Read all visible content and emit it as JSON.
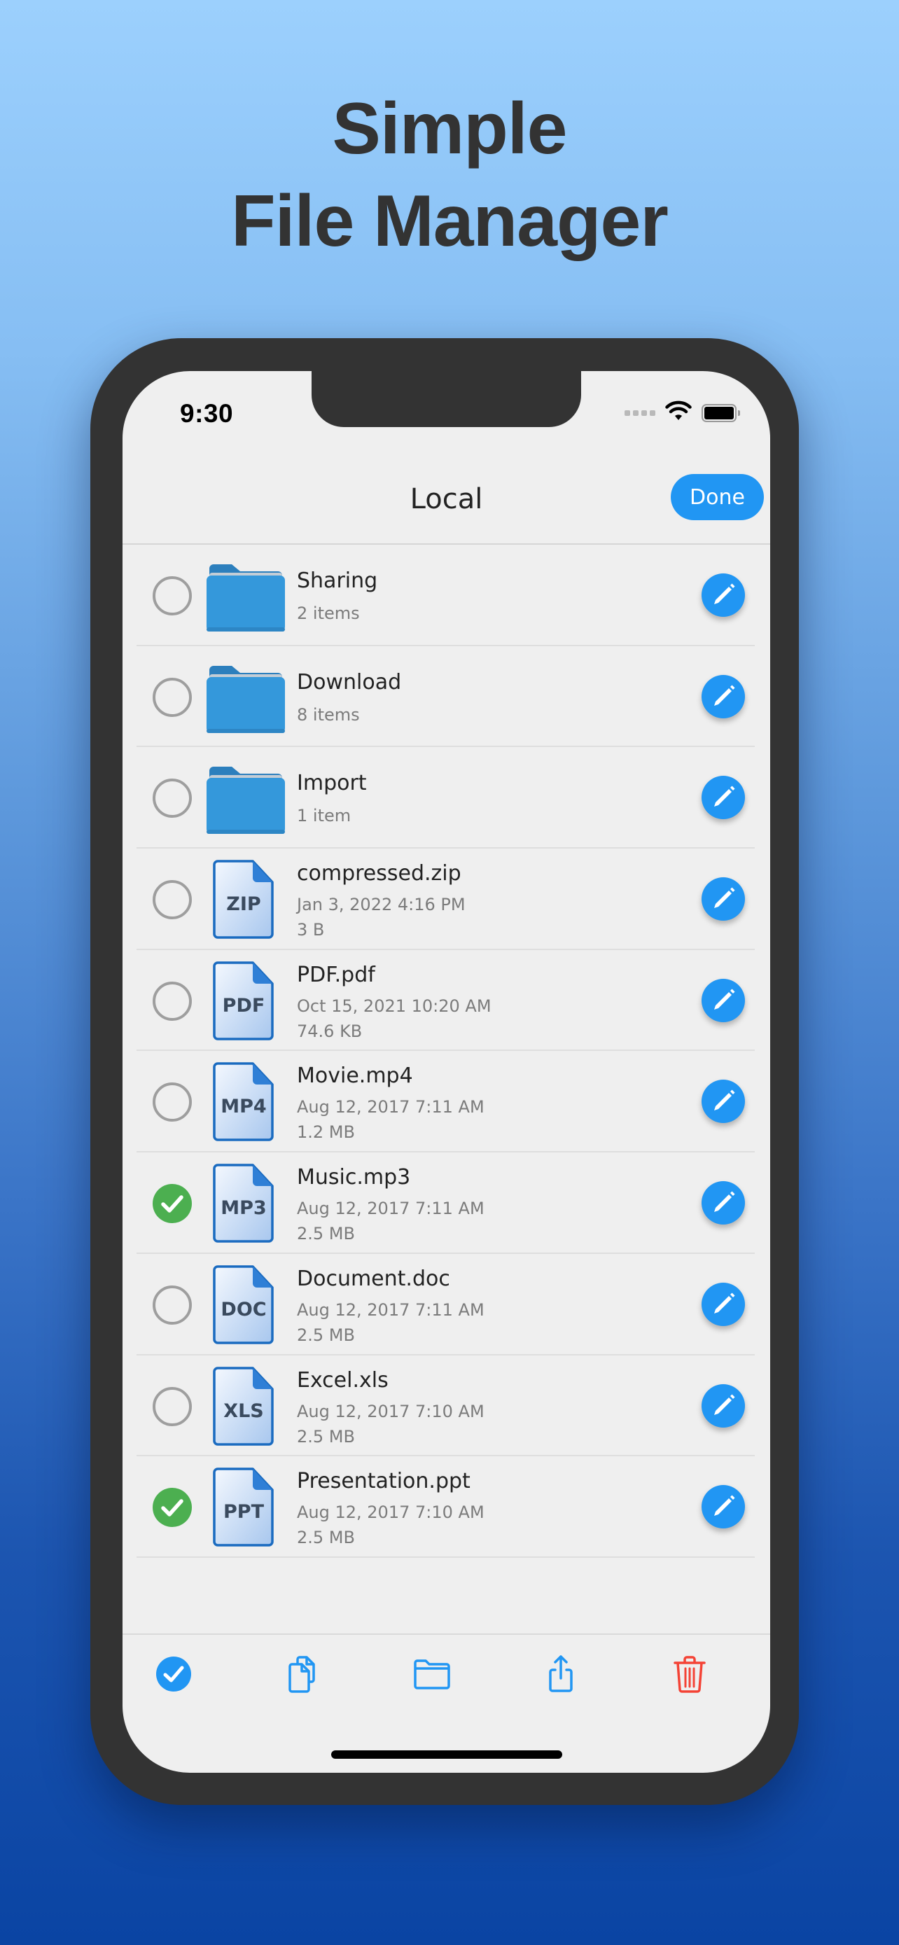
{
  "headline": {
    "line1": "Simple",
    "line2": "File Manager"
  },
  "status_bar": {
    "time": "9:30",
    "signal_icon": "signal-dots-icon",
    "wifi_icon": "wifi-icon",
    "battery_icon": "battery-full-icon"
  },
  "nav": {
    "title": "Local",
    "done_label": "Done"
  },
  "colors": {
    "accent": "#2196F3",
    "selected": "#4CAF50",
    "delete": "#F44336",
    "folder": "#3498DB",
    "frame": "#333333",
    "screen": "#EFEFEF"
  },
  "items": [
    {
      "type": "folder",
      "name": "Sharing",
      "meta1": "2 items",
      "selected": false
    },
    {
      "type": "folder",
      "name": "Download",
      "meta1": "8 items",
      "selected": false
    },
    {
      "type": "folder",
      "name": "Import",
      "meta1": "1 item",
      "selected": false
    },
    {
      "type": "file",
      "ext": "ZIP",
      "name": "compressed.zip",
      "meta1": "Jan 3, 2022 4:16 PM",
      "meta2": "3 B",
      "selected": false
    },
    {
      "type": "file",
      "ext": "PDF",
      "name": "PDF.pdf",
      "meta1": "Oct 15, 2021 10:20 AM",
      "meta2": "74.6 KB",
      "selected": false
    },
    {
      "type": "file",
      "ext": "MP4",
      "name": "Movie.mp4",
      "meta1": "Aug 12, 2017 7:11 AM",
      "meta2": "1.2 MB",
      "selected": false
    },
    {
      "type": "file",
      "ext": "MP3",
      "name": "Music.mp3",
      "meta1": "Aug 12, 2017 7:11 AM",
      "meta2": "2.5 MB",
      "selected": true
    },
    {
      "type": "file",
      "ext": "DOC",
      "name": "Document.doc",
      "meta1": "Aug 12, 2017 7:11 AM",
      "meta2": "2.5 MB",
      "selected": false
    },
    {
      "type": "file",
      "ext": "XLS",
      "name": "Excel.xls",
      "meta1": "Aug 12, 2017 7:10 AM",
      "meta2": "2.5 MB",
      "selected": false
    },
    {
      "type": "file",
      "ext": "PPT",
      "name": "Presentation.ppt",
      "meta1": "Aug 12, 2017 7:10 AM",
      "meta2": "2.5 MB",
      "selected": true
    }
  ],
  "toolbar": [
    {
      "action": "select-all",
      "icon": "check-circle-icon"
    },
    {
      "action": "copy",
      "icon": "copy-documents-icon"
    },
    {
      "action": "move",
      "icon": "folder-icon"
    },
    {
      "action": "share",
      "icon": "share-icon"
    },
    {
      "action": "delete",
      "icon": "trash-icon"
    }
  ]
}
